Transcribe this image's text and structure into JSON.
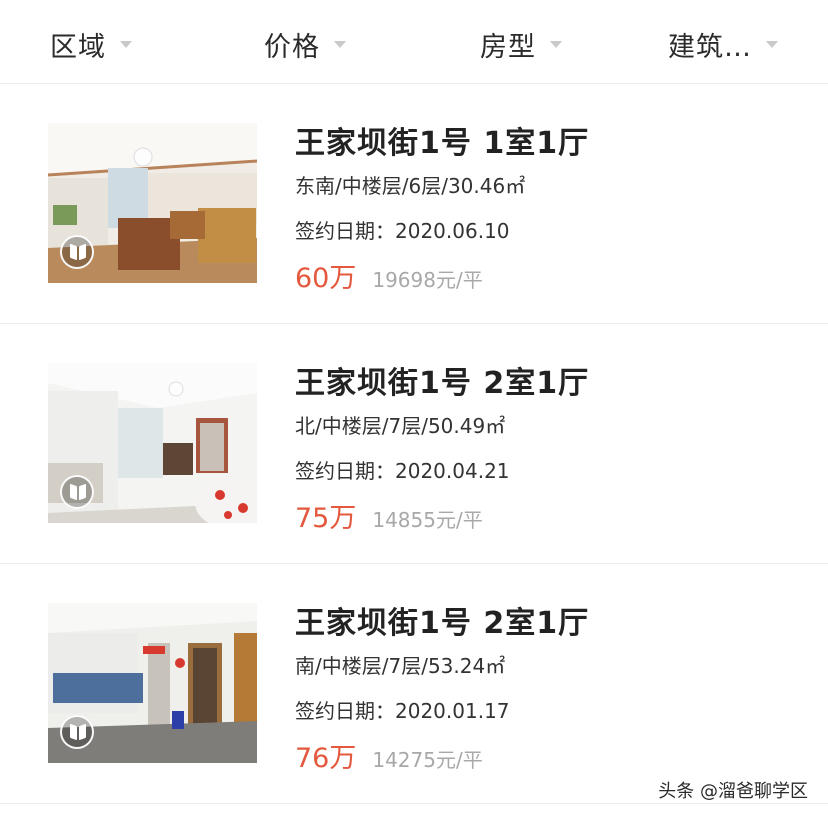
{
  "filters": [
    {
      "label": "区域"
    },
    {
      "label": "价格"
    },
    {
      "label": "房型"
    },
    {
      "label": "建筑…"
    }
  ],
  "listings": [
    {
      "title": "王家坝街1号 1室1厅",
      "meta": "东南/中楼层/6层/30.46㎡",
      "date_label": "签约日期：",
      "date": "2020.06.10",
      "price": "60万",
      "unit_price": "19698元/平"
    },
    {
      "title": "王家坝街1号 2室1厅",
      "meta": "北/中楼层/7层/50.49㎡",
      "date_label": "签约日期：",
      "date": "2020.04.21",
      "price": "75万",
      "unit_price": "14855元/平"
    },
    {
      "title": "王家坝街1号 2室1厅",
      "meta": "南/中楼层/7层/53.24㎡",
      "date_label": "签约日期：",
      "date": "2020.01.17",
      "price": "76万",
      "unit_price": "14275元/平"
    }
  ],
  "watermark": "头条 @溜爸聊学区",
  "colors": {
    "price": "#e4583e",
    "unit_price": "#a8a8a8",
    "divider": "#ececec"
  }
}
